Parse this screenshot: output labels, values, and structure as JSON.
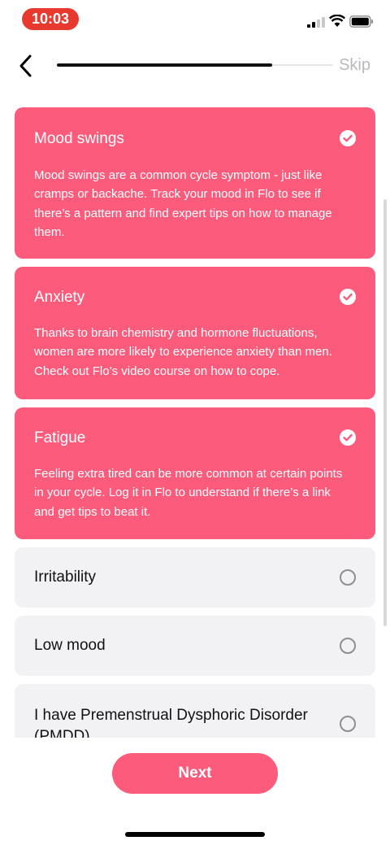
{
  "status_bar": {
    "time": "10:03"
  },
  "nav": {
    "skip_label": "Skip",
    "progress": 0.78
  },
  "options": [
    {
      "title": "Mood swings",
      "description": "Mood swings are a common cycle symptom - just like cramps or backache. Track your mood in Flo to see if there’s a pattern and find expert tips on how to manage them.",
      "selected": true
    },
    {
      "title": "Anxiety",
      "description": "Thanks to brain chemistry and hormone fluctuations, women are more likely to experience anxiety than men. Check out Flo’s video course on how to cope.",
      "selected": true
    },
    {
      "title": "Fatigue",
      "description": "Feeling extra tired can be more common at certain points in your cycle. Log it in Flo to understand if there’s a link and get tips to beat it.",
      "selected": true
    },
    {
      "title": "Irritability",
      "selected": false
    },
    {
      "title": "Low mood",
      "selected": false
    },
    {
      "title": "I have Premenstrual Dysphoric Disorder (PMDD)",
      "selected": false
    }
  ],
  "next_label": "Next",
  "colors": {
    "accent": "#fc5b7b",
    "card_bg": "#f2f2f4",
    "time_pill": "#e8392f"
  }
}
